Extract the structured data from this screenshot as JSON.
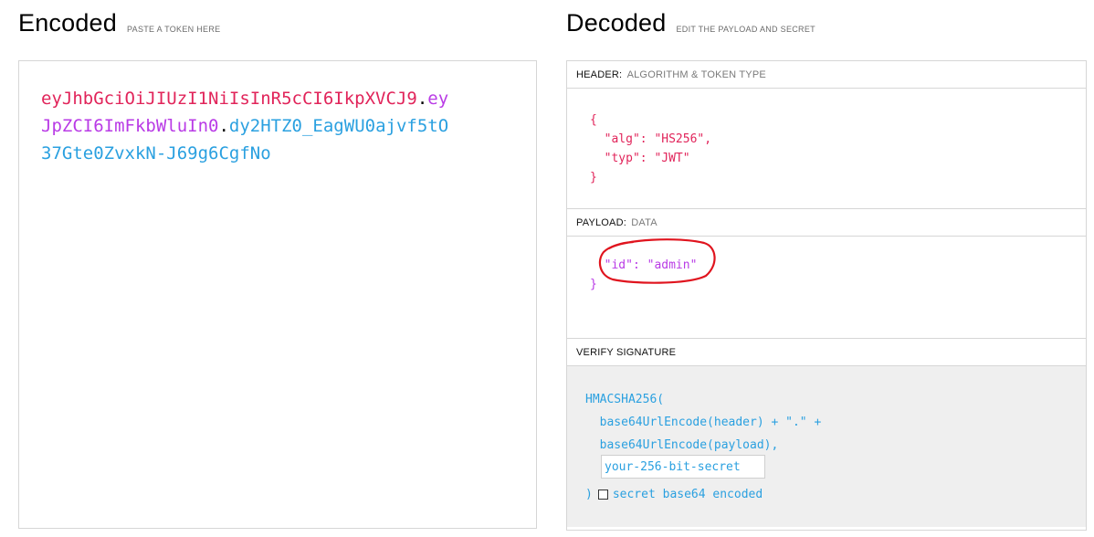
{
  "encoded": {
    "title": "Encoded",
    "subtitle": "PASTE A TOKEN HERE",
    "token_lines": [
      {
        "header": "eyJhbGciOiJIUzI1NiIsInR5cCI6IkpXVCJ9",
        "dot1": ".",
        "payload": "ey"
      },
      {
        "payload": "JpZCI6ImFkbWluIn0",
        "dot2": ".",
        "sig": "dy2HTZ0_EagWU0ajvf5tO"
      },
      {
        "sig": "37Gte0ZvxkN-J69g6CgfNo"
      }
    ]
  },
  "decoded": {
    "title": "Decoded",
    "subtitle": "EDIT THE PAYLOAD AND SECRET",
    "header_section": {
      "label": "HEADER:",
      "sublabel": "ALGORITHM & TOKEN TYPE",
      "code": "{\n  \"alg\": \"HS256\",\n  \"typ\": \"JWT\"\n}"
    },
    "payload_section": {
      "label": "PAYLOAD:",
      "sublabel": "DATA",
      "code": "  \"id\": \"admin\"\n}"
    },
    "verify_section": {
      "label": "VERIFY SIGNATURE",
      "code": "HMACSHA256(\n  base64UrlEncode(header) + \".\" +\n  base64UrlEncode(payload),",
      "secret_placeholder": "your-256-bit-secret",
      "close_paren": ")",
      "checkbox_label": "secret base64 encoded"
    }
  },
  "colors": {
    "header": "#e1245a",
    "payload": "#b93be6",
    "signature": "#2aa0e0",
    "annotation": "#e0141e"
  }
}
